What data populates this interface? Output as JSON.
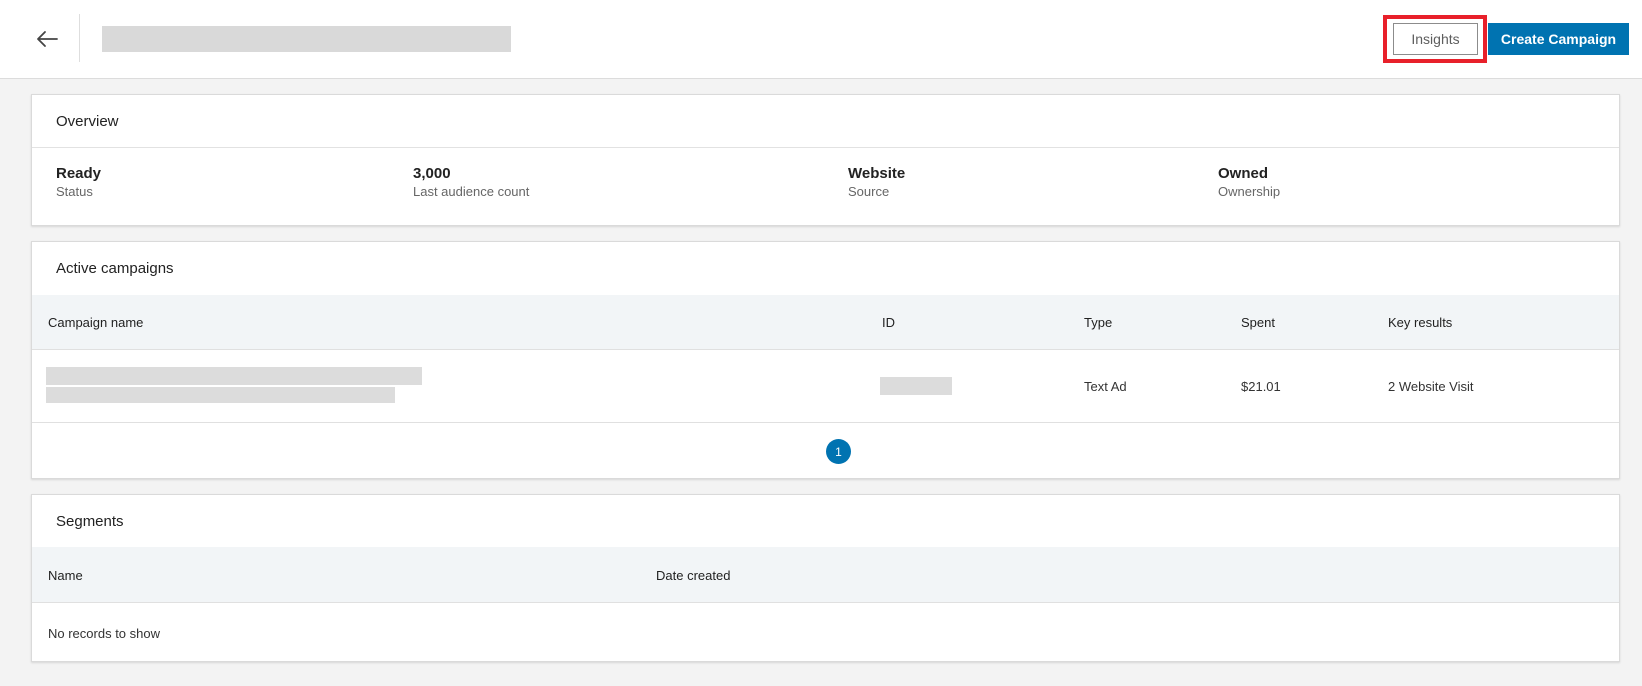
{
  "header": {
    "insights_label": "Insights",
    "create_label": "Create Campaign",
    "accent_color": "#0073b1",
    "highlight_color": "#e8202a"
  },
  "overview": {
    "title": "Overview",
    "stats": [
      {
        "value": "Ready",
        "label": "Status"
      },
      {
        "value": "3,000",
        "label": "Last audience count"
      },
      {
        "value": "Website",
        "label": "Source"
      },
      {
        "value": "Owned",
        "label": "Ownership"
      }
    ]
  },
  "campaigns": {
    "title": "Active campaigns",
    "columns": [
      "Campaign name",
      "ID",
      "Type",
      "Spent",
      "Key results"
    ],
    "rows": [
      {
        "type": "Text Ad",
        "spent": "$21.01",
        "key_results": "2 Website Visit"
      }
    ],
    "pagination": {
      "current_page": "1"
    }
  },
  "segments": {
    "title": "Segments",
    "columns": [
      "Name",
      "Date created"
    ],
    "empty_message": "No records to show"
  },
  "icons": {
    "back": "arrow-left-icon"
  }
}
